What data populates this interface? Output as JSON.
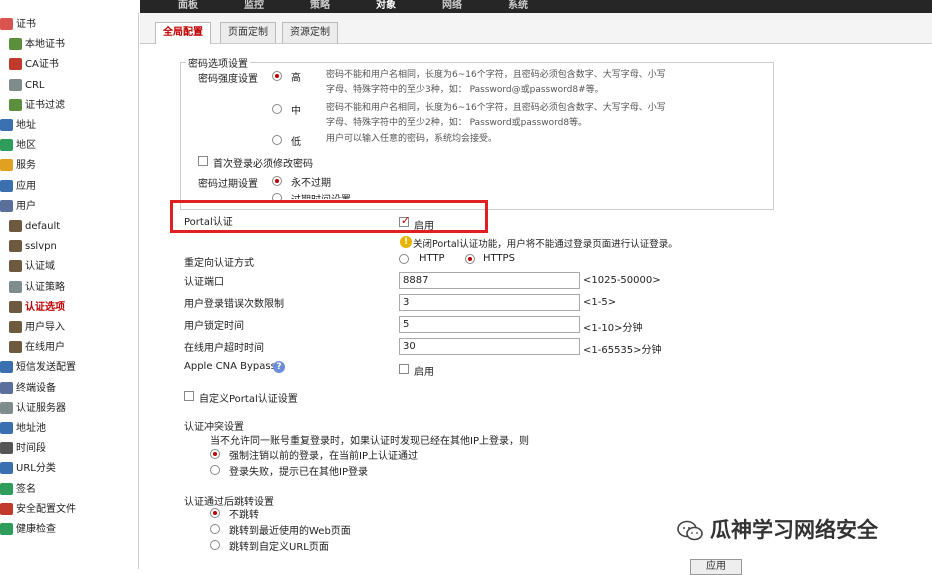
{
  "top_nav": [
    "面板",
    "监控",
    "策略",
    "对象",
    "网络",
    "系统"
  ],
  "sidebar": {
    "items": [
      {
        "label": "证书",
        "color": "#d9534f"
      },
      {
        "label": "本地证书",
        "color": "#5a8f3c"
      },
      {
        "label": "CA证书",
        "color": "#c0392b"
      },
      {
        "label": "CRL",
        "color": "#7f8c8d"
      },
      {
        "label": "证书过滤",
        "color": "#5a8f3c"
      },
      {
        "label": "地址",
        "color": "#3a6fb0"
      },
      {
        "label": "地区",
        "color": "#2e9c5a"
      },
      {
        "label": "服务",
        "color": "#e0a020"
      },
      {
        "label": "应用",
        "color": "#3a6fb0"
      },
      {
        "label": "用户",
        "color": "#5a6f9c"
      },
      {
        "label": "default",
        "color": "#6d5a3f"
      },
      {
        "label": "sslvpn",
        "color": "#6d5a3f"
      },
      {
        "label": "认证域",
        "color": "#6d5a3f"
      },
      {
        "label": "认证策略",
        "color": "#7f8c8d"
      },
      {
        "label": "认证选项",
        "color": "#6d5a3f"
      },
      {
        "label": "用户导入",
        "color": "#6d5a3f"
      },
      {
        "label": "在线用户",
        "color": "#6d5a3f"
      },
      {
        "label": "短信发送配置",
        "color": "#3a6fb0"
      },
      {
        "label": "终端设备",
        "color": "#5a6f9c"
      },
      {
        "label": "认证服务器",
        "color": "#7f8c8d"
      },
      {
        "label": "地址池",
        "color": "#3a6fb0"
      },
      {
        "label": "时间段",
        "color": "#555555"
      },
      {
        "label": "URL分类",
        "color": "#3a6fb0"
      },
      {
        "label": "签名",
        "color": "#2e9c5a"
      },
      {
        "label": "安全配置文件",
        "color": "#c0392b"
      },
      {
        "label": "健康检查",
        "color": "#2e9c5a"
      }
    ],
    "active": "认证选项"
  },
  "tabs": [
    "全局配置",
    "页面定制",
    "资源定制"
  ],
  "password": {
    "section_title": "密码选项设置",
    "strength_label": "密码强度设置",
    "high": "高",
    "high_desc_1": "密码不能和用户名相同，长度为6~16个字符，且密码必须包含数字、大写字母、小写",
    "high_desc_2": "字母、特殊字符中的至少3种，如： Password@或password8#等。",
    "mid": "中",
    "mid_desc_1": "密码不能和用户名相同，长度为6~16个字符，且密码必须包含数字、大写字母、小写",
    "mid_desc_2": "字母、特殊字符中的至少2种，如： Password或password8等。",
    "low": "低",
    "low_desc": "用户可以输入任意的密码，系统均会接受。",
    "first_login": "首次登录必须修改密码",
    "expire_label": "密码过期设置",
    "never_expire": "永不过期",
    "expire_time": "过期时间设置"
  },
  "portal": {
    "label": "Portal认证",
    "enable": "启用",
    "warning": "关闭Portal认证功能，用户将不能通过登录页面进行认证登录。"
  },
  "redirect": {
    "label": "重定向认证方式",
    "http": "HTTP",
    "https": "HTTPS"
  },
  "port": {
    "label": "认证端口",
    "value": "8887",
    "hint": "<1025-50000>"
  },
  "login_fail": {
    "label": "用户登录错误次数限制",
    "value": "3",
    "hint": "<1-5>"
  },
  "lock_time": {
    "label": "用户锁定时间",
    "value": "5",
    "hint": "<1-10>分钟"
  },
  "timeout": {
    "label": "在线用户超时时间",
    "value": "30",
    "hint": "<1-65535>分钟"
  },
  "apple_cna": {
    "label": "Apple CNA Bypass",
    "enable": "启用"
  },
  "custom_portal": "自定义Portal认证设置",
  "conflict": {
    "title": "认证冲突设置",
    "desc": "当不允许同一账号重复登录时，如果认证时发现已经在其他IP上登录，则",
    "opt1": "强制注销以前的登录，在当前IP上认证通过",
    "opt2": "登录失败，提示已在其他IP登录"
  },
  "redirect_after": {
    "title": "认证通过后跳转设置",
    "opt1": "不跳转",
    "opt2": "跳转到最近使用的Web页面",
    "opt3": "跳转到自定义URL页面"
  },
  "apply_button": "应用",
  "watermark": "瓜神学习网络安全"
}
